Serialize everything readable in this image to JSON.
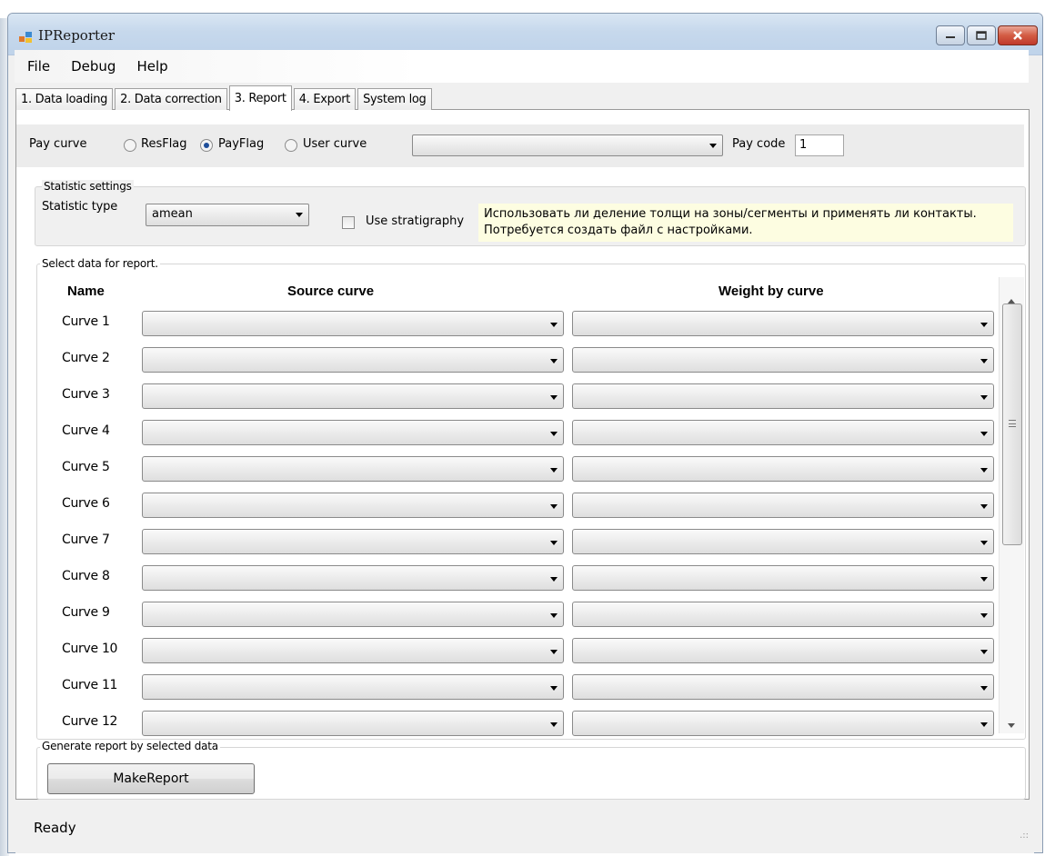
{
  "window": {
    "title": "IPReporter"
  },
  "menu": {
    "items": [
      "File",
      "Debug",
      "Help"
    ]
  },
  "tabs": [
    {
      "label": "1. Data loading",
      "active": false
    },
    {
      "label": "2. Data correction",
      "active": false
    },
    {
      "label": "3. Report",
      "active": true
    },
    {
      "label": "4. Export",
      "active": false
    },
    {
      "label": "System log",
      "active": false
    }
  ],
  "pay": {
    "label": "Pay curve",
    "options": [
      {
        "label": "ResFlag",
        "selected": false
      },
      {
        "label": "PayFlag",
        "selected": true
      },
      {
        "label": "User curve",
        "selected": false
      }
    ],
    "user_curve_value": "",
    "code_label": "Pay code",
    "code_value": "1"
  },
  "statistic": {
    "group_title": "Statistic settings",
    "type_label": "Statistic type",
    "type_value": "amean",
    "stratigraphy_label": "Use stratigraphy",
    "stratigraphy_checked": false,
    "note": "Использовать ли деление толщи на зоны/сегменты и применять ли контакты. Потребуется создать файл с настройками."
  },
  "selection": {
    "group_title": "Select data for report.",
    "headers": {
      "name": "Name",
      "source": "Source curve",
      "weight": "Weight by curve"
    },
    "rows": [
      {
        "name": "Curve 1",
        "source": "",
        "weight": ""
      },
      {
        "name": "Curve 2",
        "source": "",
        "weight": ""
      },
      {
        "name": "Curve 3",
        "source": "",
        "weight": ""
      },
      {
        "name": "Curve 4",
        "source": "",
        "weight": ""
      },
      {
        "name": "Curve 5",
        "source": "",
        "weight": ""
      },
      {
        "name": "Curve 6",
        "source": "",
        "weight": ""
      },
      {
        "name": "Curve 7",
        "source": "",
        "weight": ""
      },
      {
        "name": "Curve 8",
        "source": "",
        "weight": ""
      },
      {
        "name": "Curve 9",
        "source": "",
        "weight": ""
      },
      {
        "name": "Curve 10",
        "source": "",
        "weight": ""
      },
      {
        "name": "Curve 11",
        "source": "",
        "weight": ""
      },
      {
        "name": "Curve 12",
        "source": "",
        "weight": ""
      }
    ]
  },
  "generate": {
    "group_title": "Generate report by selected data",
    "button": "MakeReport"
  },
  "status": {
    "text": "Ready"
  },
  "colors": {
    "note_bg": "#fdfde1",
    "close_button": "#c0392b",
    "selected_radio": "#1f4e9a"
  }
}
